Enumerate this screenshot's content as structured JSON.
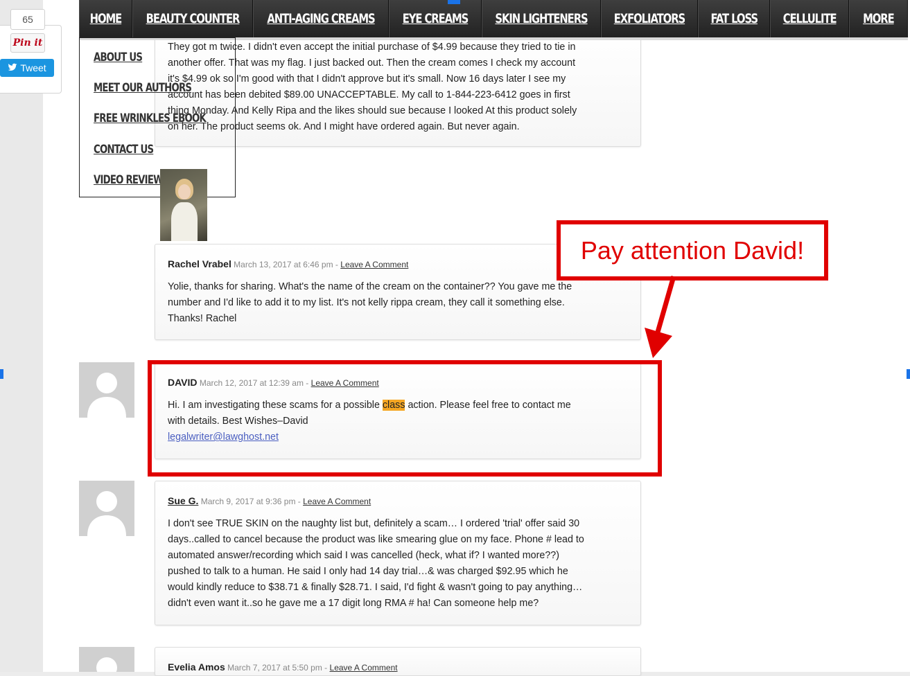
{
  "share": {
    "count": "65",
    "pin_label": "Pin it",
    "tweet_label": "Tweet"
  },
  "nav": {
    "items": [
      "HOME",
      "BEAUTY COUNTER",
      "ANTI-AGING CREAMS",
      "EYE CREAMS",
      "SKIN LIGHTENERS",
      "EXFOLIATORS",
      "FAT LOSS",
      "CELLULITE",
      "MORE"
    ]
  },
  "dropdown": {
    "items": [
      "ABOUT US",
      "MEET OUR AUTHORS",
      "FREE WRINKLES EBOOK",
      "CONTACT US",
      "VIDEO REVIEWS"
    ]
  },
  "comments": {
    "first": {
      "lines": [
        "They got m twice. I didn't even accept the initial purchase of $4.99 because they tried to tie in",
        "another offer. That was my flag. I just backed out. Then the cream comes I check my account",
        "it's $4.99 ok so I'm good with that I didn't approve but it's small. Now 16 days later I see my",
        "account has been debited $89.00 UNACCEPTABLE. My call to 1-844-223-6412 goes in first",
        "thing Monday. And Kelly Ripa and the likes should sue because I looked At this product solely",
        "on her. The product seems ok. And I might have ordered again. But never again."
      ]
    },
    "rachel": {
      "author": "Rachel Vrabel",
      "date": "March 13, 2017 at 6:46 pm",
      "separator": " - ",
      "reply": "Leave A Comment",
      "lines": [
        "Yolie, thanks for sharing. What's the name of the cream on the container?? You gave me the",
        "number and I'd like to add it to my list. It's not kelly rippa cream, they call it something else.",
        "Thanks! Rachel"
      ]
    },
    "david": {
      "author": "DAVID",
      "date": "March 12, 2017 at 12:39 am",
      "separator": " - ",
      "reply": "Leave A Comment",
      "line1_pre": "Hi. I am investigating these scams for a possible ",
      "line1_highlight": "class",
      "line1_post": " action. Please feel free to contact me",
      "line2": "with details. Best Wishes–David",
      "email": "legalwriter@lawghost.net"
    },
    "sue": {
      "author": "Sue G.",
      "date": "March 9, 2017 at 9:36 pm",
      "separator": " - ",
      "reply": "Leave A Comment",
      "lines": [
        "I don't see TRUE SKIN on the naughty list but, definitely a scam… I ordered 'trial' offer said 30",
        "days..called to cancel because the product was like smearing glue on my face. Phone # lead to",
        "automated answer/recording which said I was cancelled (heck, what if? I wanted more??)",
        "pushed to talk to a human. He said I only had 14 day trial…& was charged $92.95 which he",
        "would kindly reduce to $38.71 & finally $28.71. I said, I'd fight & wasn't going to pay anything…",
        "didn't even want it..so he gave me a 17 digit long RMA # ha! Can someone help me?"
      ]
    },
    "evelia": {
      "author": "Evelia Amos",
      "date": "March 7, 2017 at 5:50 pm",
      "separator": " - ",
      "reply": "Leave A Comment"
    }
  },
  "annotation": {
    "callout_text": "Pay attention David!",
    "color": "#e00000"
  }
}
